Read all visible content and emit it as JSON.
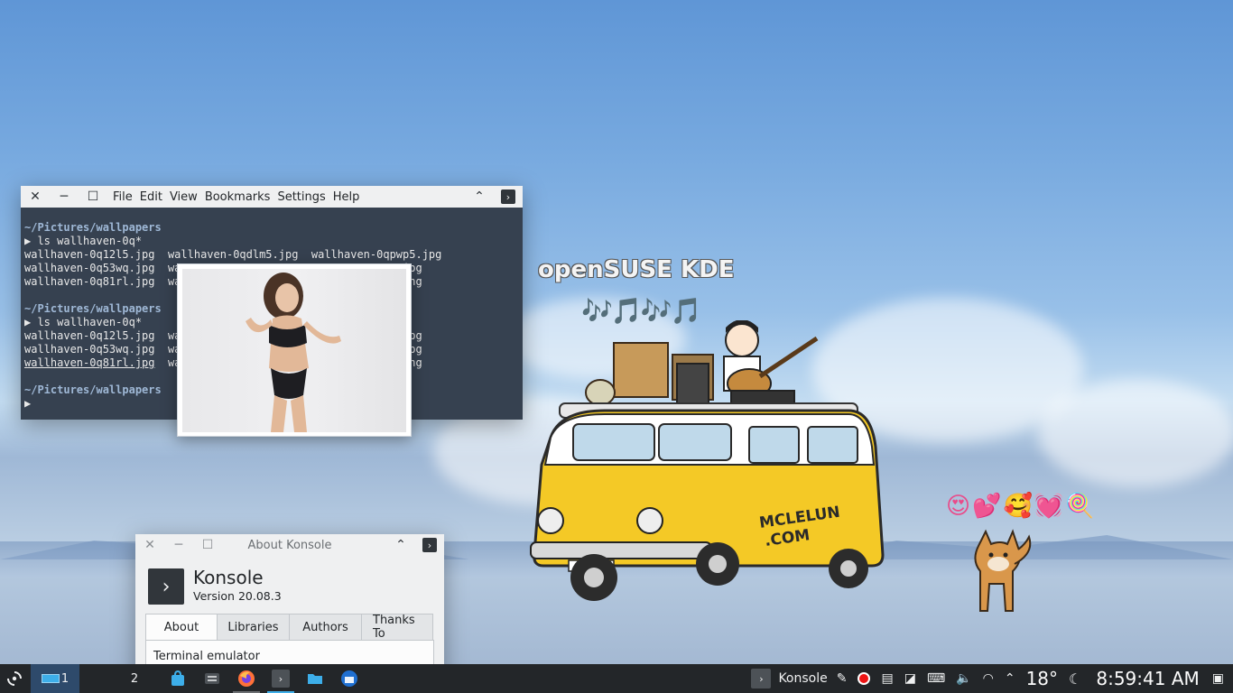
{
  "wallpaper": {
    "title": "openSUSE KDE",
    "notes": "🎶🎵🎶🎵",
    "emojis": "😍💕🥰💓🍭"
  },
  "konsole": {
    "menu": [
      "File",
      "Edit",
      "View",
      "Bookmarks",
      "Settings",
      "Help"
    ],
    "lines": [
      {
        "text": "",
        "cls": ""
      },
      {
        "text": "~/Pictures/wallpapers",
        "cls": "path"
      },
      {
        "text": "▶ ls wallhaven-0q*",
        "cls": ""
      },
      {
        "text": "wallhaven-0q12l5.jpg  wallhaven-0qdlm5.jpg  wallhaven-0qpwp5.jpg",
        "cls": ""
      },
      {
        "text": "wallhaven-0q53wq.jpg  wa                                  jpg",
        "cls": ""
      },
      {
        "text": "wallhaven-0q81rl.jpg  wa                                  png",
        "cls": ""
      },
      {
        "text": "",
        "cls": ""
      },
      {
        "text": "~/Pictures/wallpapers",
        "cls": "path"
      },
      {
        "text": "▶ ls wallhaven-0q*",
        "cls": ""
      },
      {
        "text": "wallhaven-0q12l5.jpg  wa                                  jpg",
        "cls": ""
      },
      {
        "text": "wallhaven-0q53wq.jpg  wa                                  jpg",
        "cls": ""
      },
      {
        "text": "wallhaven-0q81rl.jpg  wa                                  png",
        "cls": "ul-first"
      },
      {
        "text": "",
        "cls": ""
      },
      {
        "text": "~/Pictures/wallpapers",
        "cls": "path"
      },
      {
        "text": "▶",
        "cls": ""
      }
    ]
  },
  "about": {
    "title": "About Konsole",
    "app_name": "Konsole",
    "version": "Version 20.08.3",
    "tabs": [
      "About",
      "Libraries",
      "Authors",
      "Thanks To"
    ],
    "description": "Terminal emulator"
  },
  "taskbar": {
    "desktops": [
      "1",
      "2"
    ],
    "active_window": "Konsole",
    "temperature": "18°",
    "clock": "8:59:41 AM"
  }
}
